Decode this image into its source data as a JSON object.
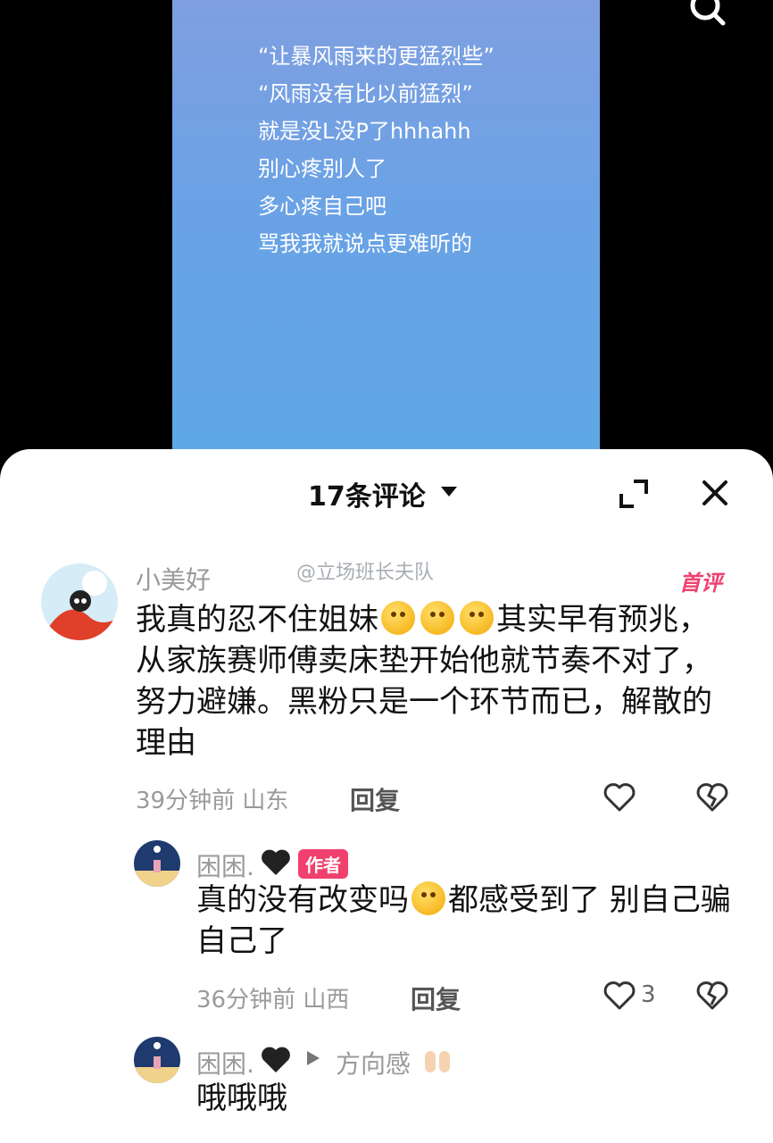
{
  "video": {
    "lyrics": [
      "“让暴风雨来的更猛烈些”",
      "“风雨没有比以前猛烈”",
      "就是没L没P了hhhahh",
      "别心疼别人了",
      "多心疼自己吧",
      "骂我我就说点更难听的"
    ]
  },
  "panel": {
    "title": "17条评论"
  },
  "watermark": "@立场班长夫队",
  "comments": [
    {
      "user": "小美好",
      "badge": "首评",
      "text_before": "我真的忍不住姐妹",
      "text_after": "其实早有预兆，从家族赛师傅卖床垫开始他就节奏不对了，努力避嫌。黑粉只是一个环节而已，解散的理由",
      "time": "39分钟前",
      "location": "山东",
      "reply_label": "回复"
    }
  ],
  "replies": [
    {
      "user": "困困.",
      "badge": "作者",
      "text_before": "真的没有改变吗",
      "text_after": "都感受到了 别自己骗自己了",
      "time": "36分钟前",
      "location": "山西",
      "reply_label": "回复",
      "likes": "3"
    },
    {
      "user": "困困.",
      "reply_to": "方向感",
      "text": "哦哦哦"
    }
  ],
  "colors": {
    "accent": "#f0416e",
    "video_bg": "#6aa2e6"
  }
}
